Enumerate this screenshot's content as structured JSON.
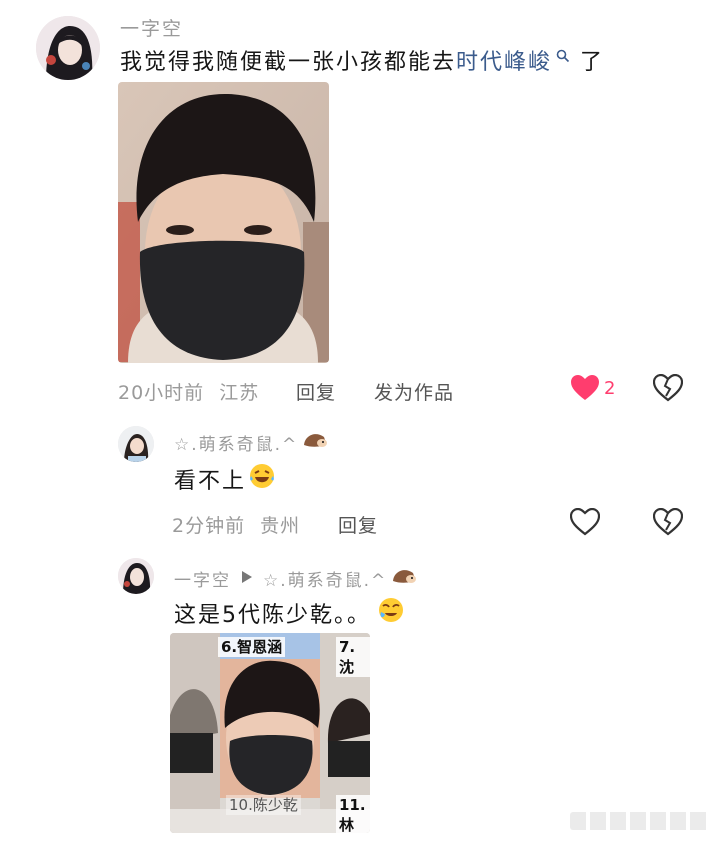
{
  "comments": [
    {
      "username": "一字空",
      "text_main": "我觉得我随便截一张小孩都能去",
      "text_link": "时代峰峻",
      "text_suffix": "了",
      "time": "20小时前",
      "location": "江苏",
      "reply_label": "回复",
      "publish_label": "发为作品",
      "like_count": "2"
    },
    {
      "username": "☆.萌系奇鼠.^",
      "text": "看不上",
      "time": "2分钟前",
      "location": "贵州",
      "reply_label": "回复"
    },
    {
      "username": "一字空",
      "reply_target": "☆.萌系奇鼠.^",
      "text": "这是5代陈少乾。。",
      "grid_labels": [
        "6.智恩涵",
        "7.沈",
        "10.陈少乾",
        "11.林"
      ]
    }
  ],
  "colors": {
    "like_active": "#ff3d6e",
    "link": "#3b5b8c",
    "muted": "#9a9a9a"
  }
}
